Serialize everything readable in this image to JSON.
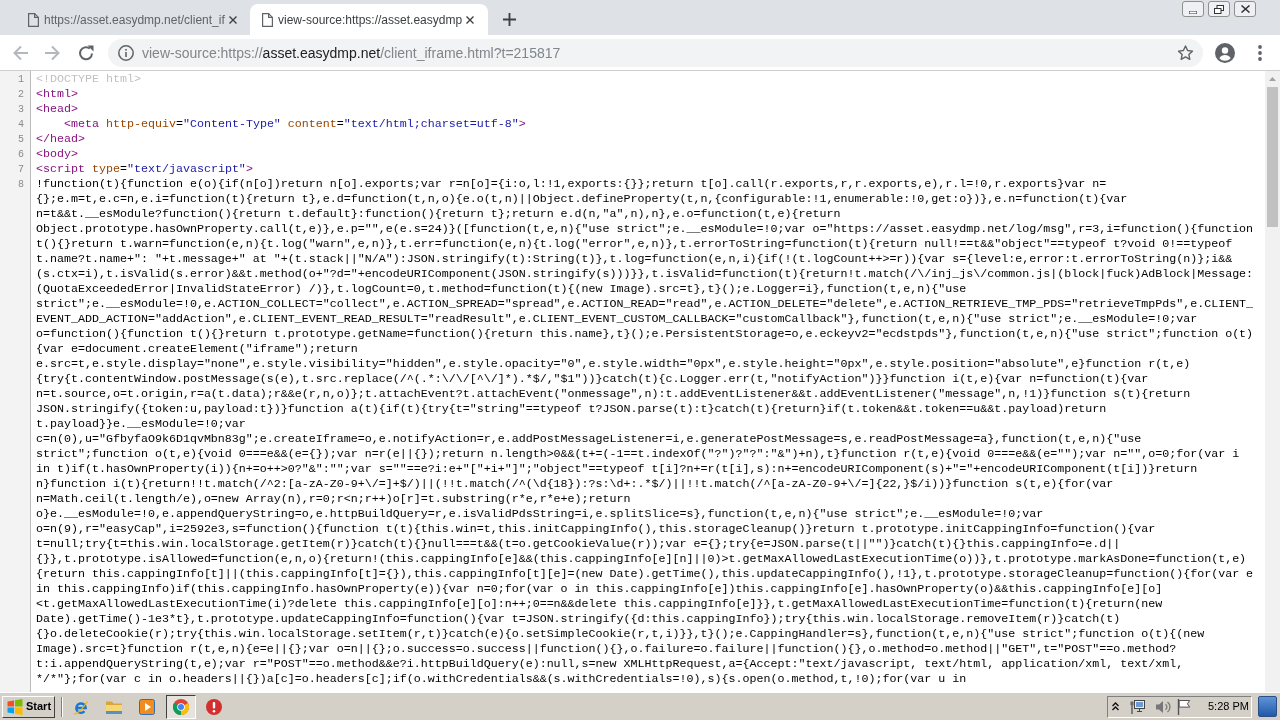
{
  "browser": {
    "tabs": [
      {
        "title": "https://asset.easydmp.net/client_if",
        "selected": false
      },
      {
        "title": "view-source:https://asset.easydmp",
        "selected": true
      }
    ],
    "nav_buttons": [
      {
        "kind": "back",
        "disabled": true
      },
      {
        "kind": "forward",
        "disabled": true
      },
      {
        "kind": "reload",
        "disabled": false
      }
    ],
    "address_bar": {
      "url_parts": [
        {
          "text": "view-source:https://",
          "emphasized": false
        },
        {
          "text": "asset.easydmp.net",
          "emphasized": true
        },
        {
          "text": "/client_iframe.html?t=215817",
          "emphasized": false
        }
      ]
    }
  },
  "source": {
    "lines": [
      {
        "number": "1",
        "kind": "markup",
        "tokens": [
          {
            "kind": "doctype",
            "text": "<!DOCTYPE html>"
          }
        ]
      },
      {
        "number": "2",
        "kind": "markup",
        "tokens": [
          {
            "kind": "tag",
            "text": "<html>"
          }
        ]
      },
      {
        "number": "3",
        "kind": "markup",
        "tokens": [
          {
            "kind": "tag",
            "text": "<head>"
          }
        ],
        "children": [
          {
            "number": "4",
            "kind": "markup",
            "tokens": [
              {
                "kind": "tag",
                "text": "<meta"
              },
              {
                "kind": "attribute",
                "text": " http-equiv"
              },
              {
                "kind": "plain",
                "text": "="
              },
              {
                "kind": "value",
                "text": "\"Content-Type\""
              },
              {
                "kind": "attribute",
                "text": " content"
              },
              {
                "kind": "plain",
                "text": "="
              },
              {
                "kind": "value",
                "text": "\"text/html;charset=utf-8\""
              },
              {
                "kind": "tag",
                "text": ">"
              }
            ]
          }
        ]
      },
      {
        "number": "5",
        "kind": "markup",
        "tokens": [
          {
            "kind": "tag",
            "text": "</head>"
          }
        ]
      },
      {
        "number": "6",
        "kind": "markup",
        "tokens": [
          {
            "kind": "tag",
            "text": "<body>"
          }
        ]
      },
      {
        "number": "7",
        "kind": "markup",
        "tokens": [
          {
            "kind": "tag",
            "text": "<script"
          },
          {
            "kind": "attribute",
            "text": " type"
          },
          {
            "kind": "plain",
            "text": "="
          },
          {
            "kind": "value",
            "text": "\"text/javascript\""
          },
          {
            "kind": "tag",
            "text": ">"
          }
        ]
      },
      {
        "number": "8",
        "kind": "script",
        "rows": [
          "!function(t){function e(o){if(n[o])return n[o].exports;var r=n[o]={i:o,l:!1,exports:{}};return t[o].call(r.exports,r,r.exports,e),r.l=!0,r.exports}var n=",
          "{};e.m=t,e.c=n,e.i=function(t){return t},e.d=function(t,n,o){e.o(t,n)||Object.defineProperty(t,n,{configurable:!1,enumerable:!0,get:o})},e.n=function(t){var",
          "n=t&&t.__esModule?function(){return t.default}:function(){return t};return e.d(n,\"a\",n),n},e.o=function(t,e){return",
          "Object.prototype.hasOwnProperty.call(t,e)},e.p=\"\",e(e.s=24)}([function(t,e,n){\"use strict\";e.__esModule=!0;var o=\"https://asset.easydmp.net/log/msg\",r=3,i=function(){function",
          "t(){}return t.warn=function(e,n){t.log(\"warn\",e,n)},t.err=function(e,n){t.log(\"error\",e,n)},t.errorToString=function(t){return null!==t&&\"object\"==typeof t?void 0!==typeof",
          "t.name?t.name+\": \"+t.message+\" at \"+(t.stack||\"N/A\"):JSON.stringify(t):String(t)},t.log=function(e,n,i){if(!(t.logCount++>=r)){var s={level:e,error:t.errorToString(n)};i&&",
          "(s.ctx=i),t.isValid(s.error)&&t.method(o+\"?d=\"+encodeURIComponent(JSON.stringify(s)))}},t.isValid=function(t){return!t.match(/\\/inj_js\\/common.js|(block|fuck)AdBlock|Message:",
          "(QuotaExceededError|InvalidStateError) /)},t.logCount=0,t.method=function(t){(new Image).src=t},t}();e.Logger=i},function(t,e,n){\"use",
          "strict\";e.__esModule=!0,e.ACTION_COLLECT=\"collect\",e.ACTION_SPREAD=\"spread\",e.ACTION_READ=\"read\",e.ACTION_DELETE=\"delete\",e.ACTION_RETRIEVE_TMP_PDS=\"retrieveTmpPds\",e.CLIENT_",
          "EVENT_ADD_ACTION=\"addAction\",e.CLIENT_EVENT_READ_RESULT=\"readResult\",e.CLIENT_EVENT_CUSTOM_CALLBACK=\"customCallback\"},function(t,e,n){\"use strict\";e.__esModule=!0;var",
          "o=function(){function t(){}return t.prototype.getName=function(){return this.name},t}();e.PersistentStorage=o,e.eckeyv2=\"ecdstpds\"},function(t,e,n){\"use strict\";function o(t)",
          "{var e=document.createElement(\"iframe\");return",
          "e.src=t,e.style.display=\"none\",e.style.visibility=\"hidden\",e.style.opacity=\"0\",e.style.width=\"0px\",e.style.height=\"0px\",e.style.position=\"absolute\",e}function r(t,e)",
          "{try{t.contentWindow.postMessage(s(e),t.src.replace(/^(.*:\\/\\/[^\\/]*).*$/,\"$1\"))}catch(t){c.Logger.err(t,\"notifyAction\")}}function i(t,e){var n=function(t){var",
          "n=t.source,o=t.origin,r=a(t.data);r&&e(r,n,o)};t.attachEvent?t.attachEvent(\"onmessage\",n):t.addEventListener&&t.addEventListener(\"message\",n,!1)}function s(t){return",
          "JSON.stringify({token:u,payload:t})}function a(t){if(t){try{t=\"string\"==typeof t?JSON.parse(t):t}catch(t){return}if(t.token&&t.token==u&&t.payload)return",
          "t.payload}}e.__esModule=!0;var",
          "c=n(0),u=\"GfbyfaO9k6D1qvMbn83g\";e.createIframe=o,e.notifyAction=r,e.addPostMessageListener=i,e.generatePostMessage=s,e.readPostMessage=a},function(t,e,n){\"use",
          "strict\";function o(t,e){void 0===e&&(e={});var n=r(e||{});return n.length>0&&(t+=(-1==t.indexOf(\"?\")?\"?\":\"&\")+n),t}function r(t,e){void 0===e&&(e=\"\");var n=\"\",o=0;for(var i",
          "in t)if(t.hasOwnProperty(i)){n+=o++>0?\"&\":\"\";var s=\"\"==e?i:e+\"[\"+i+\"]\";\"object\"==typeof t[i]?n+=r(t[i],s):n+=encodeURIComponent(s)+\"=\"+encodeURIComponent(t[i])}return",
          "n}function i(t){return!!t.match(/^2:[a-zA-Z0-9+\\/=]+$/)||(!!t.match(/^(\\d{18}):?s:\\d+:.*$/)||!!t.match(/^[a-zA-Z0-9+\\/=]{22,}$/i))}function s(t,e){for(var",
          "n=Math.ceil(t.length/e),o=new Array(n),r=0;r<n;r++)o[r]=t.substring(r*e,r*e+e);return",
          "o}e.__esModule=!0,e.appendQueryString=o,e.httpBuildQuery=r,e.isValidPdsString=i,e.splitSlice=s},function(t,e,n){\"use strict\";e.__esModule=!0;var",
          "o=n(9),r=\"easyCap\",i=2592e3,s=function(){function t(t){this.win=t,this.initCappingInfo(),this.storageCleanup()}return t.prototype.initCappingInfo=function(){var",
          "t=null;try{t=this.win.localStorage.getItem(r)}catch(t){}null===t&&(t=o.getCookieValue(r));var e={};try{e=JSON.parse(t||\"\")}catch(t){}this.cappingInfo=e.d||",
          "{}},t.prototype.isAllowed=function(e,n,o){return!(this.cappingInfo[e]&&(this.cappingInfo[e][n]||0)>t.getMaxAllowedLastExecutionTime(o))},t.prototype.markAsDone=function(t,e)",
          "{return this.cappingInfo[t]||(this.cappingInfo[t]={}),this.cappingInfo[t][e]=(new Date).getTime(),this.updateCappingInfo(),!1},t.prototype.storageCleanup=function(){for(var e",
          "in this.cappingInfo)if(this.cappingInfo.hasOwnProperty(e)){var n=0;for(var o in this.cappingInfo[e])this.cappingInfo[e].hasOwnProperty(o)&&this.cappingInfo[e][o]",
          "<t.getMaxAllowedLastExecutionTime(i)?delete this.cappingInfo[e][o]:n++;0==n&&delete this.cappingInfo[e]}},t.getMaxAllowedLastExecutionTime=function(t){return(new",
          "Date).getTime()-1e3*t},t.prototype.updateCappingInfo=function(){var t=JSON.stringify({d:this.cappingInfo});try{this.win.localStorage.removeItem(r)}catch(t)",
          "{}o.deleteCookie(r);try{this.win.localStorage.setItem(r,t)}catch(e){o.setSimpleCookie(r,t,i)}},t}();e.CappingHandler=s},function(t,e,n){\"use strict\";function o(t){(new",
          "Image).src=t}function r(t,e,n){e=e||{};var o=n||{};o.success=o.success||function(){},o.failure=o.failure||function(){},o.method=o.method||\"GET\",t=\"POST\"==o.method?",
          "t:i.appendQueryString(t,e);var r=\"POST\"==o.method&&e?i.httpBuildQuery(e):null,s=new XMLHttpRequest,a={Accept:\"text/javascript, text/html, application/xml, text/xml,",
          "*/*\"};for(var c in o.headers||{})a[c]=o.headers[c];if(o.withCredentials&&(s.withCredentials=!0),s){s.open(o.method,t,!0);for(var u in"
        ]
      }
    ]
  },
  "taskbar": {
    "start_label": "Start",
    "task_buttons": [
      {
        "kind": "browser",
        "active": true
      },
      {
        "kind": "alert",
        "active": false
      }
    ],
    "clock": "5:28 PM"
  }
}
